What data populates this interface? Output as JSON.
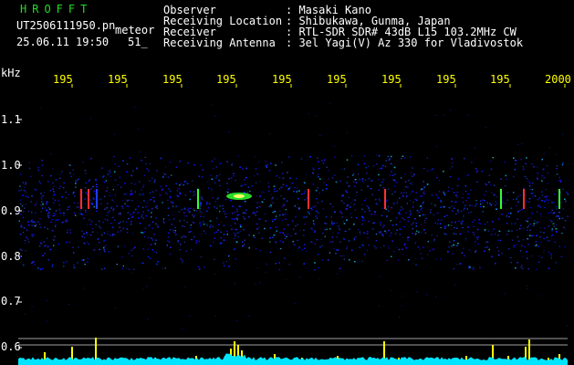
{
  "header": {
    "program_name": "HROFFT",
    "file_name": "UT2506111950.pn",
    "mode_label": "meteor",
    "timestamp": "25.06.11 19:50",
    "frame_number": "51_",
    "info_labels": [
      "Observer",
      "Receiving Location",
      "Receiver",
      "Receiving Antenna"
    ],
    "info_values": [
      ": Masaki Kano",
      ": Shibukawa, Gunma, Japan",
      ": RTL-SDR SDR# 43dB L15 103.2MHz CW",
      ": 3el Yagi(V) Az 330 for Vladivostok"
    ]
  },
  "axis": {
    "unit_label": "kHz",
    "y_tick_labels": [
      "1.1",
      "1.0",
      "0.9",
      "0.8",
      "0.7",
      "0.6"
    ],
    "x_tick_labels": [
      "195",
      "195",
      "195",
      "195",
      "195",
      "195",
      "195",
      "195",
      "195",
      "2000"
    ]
  },
  "colors": {
    "background": "#000000",
    "text_white": "#ffffff",
    "text_yellow": "#ffff00",
    "title_green": "#22dd22",
    "noise_blue": "#1f3cff",
    "meteor_red": "#ff3030",
    "meteor_green": "#33ff33",
    "signal_bar_yellow": "#ffff00",
    "baseline_cyan": "#00e5ff",
    "grid_line": "#a0a0a0"
  }
}
